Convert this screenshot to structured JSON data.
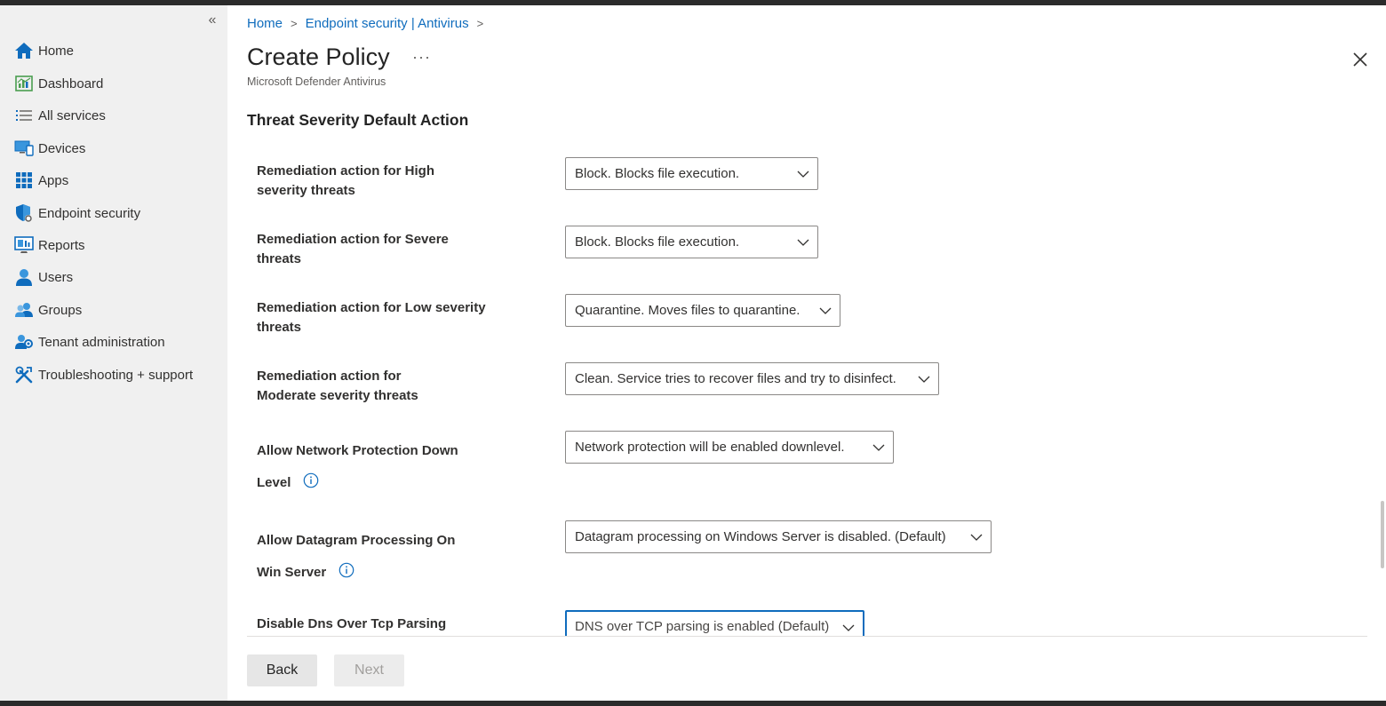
{
  "sidebar": {
    "collapse_glyph": "«",
    "items": [
      {
        "label": "Home",
        "icon": "home-icon"
      },
      {
        "label": "Dashboard",
        "icon": "dashboard-icon"
      },
      {
        "label": "All services",
        "icon": "list-icon"
      },
      {
        "label": "Devices",
        "icon": "devices-icon"
      },
      {
        "label": "Apps",
        "icon": "apps-icon"
      },
      {
        "label": "Endpoint security",
        "icon": "shield-icon"
      },
      {
        "label": "Reports",
        "icon": "reports-icon"
      },
      {
        "label": "Users",
        "icon": "user-icon"
      },
      {
        "label": "Groups",
        "icon": "groups-icon"
      },
      {
        "label": "Tenant administration",
        "icon": "tenant-admin-icon"
      },
      {
        "label": "Troubleshooting + support",
        "icon": "tools-icon"
      }
    ]
  },
  "header": {
    "breadcrumb": [
      "Home",
      "Endpoint security | Antivirus"
    ],
    "title": "Create Policy",
    "more_glyph": "···",
    "subtitle": "Microsoft Defender Antivirus"
  },
  "section": {
    "heading": "Threat Severity Default Action",
    "settings": [
      {
        "label": "Remediation action for High severity threats",
        "value": "Block. Blocks file execution."
      },
      {
        "label": "Remediation action for Severe threats",
        "value": "Block. Blocks file execution."
      },
      {
        "label": "Remediation action for Low severity threats",
        "value": "Quarantine. Moves files to quarantine."
      },
      {
        "label": "Remediation action for Moderate severity threats",
        "value": "Clean. Service tries to recover files and try to disinfect."
      },
      {
        "label_line1": "Allow Network Protection Down",
        "label_line2": "Level",
        "value": "Network protection will be enabled downlevel."
      },
      {
        "label_line1": "Allow Datagram Processing On",
        "label_line2": "Win Server",
        "value": "Datagram processing on Windows Server is disabled. (Default)"
      },
      {
        "label": "Disable Dns Over Tcp Parsing",
        "value": "DNS over TCP parsing is enabled (Default)"
      }
    ]
  },
  "footer": {
    "back_label": "Back",
    "next_label": "Next"
  },
  "colors": {
    "accent": "#0f6cbd",
    "sidebar_bg": "#f0f0f0"
  }
}
